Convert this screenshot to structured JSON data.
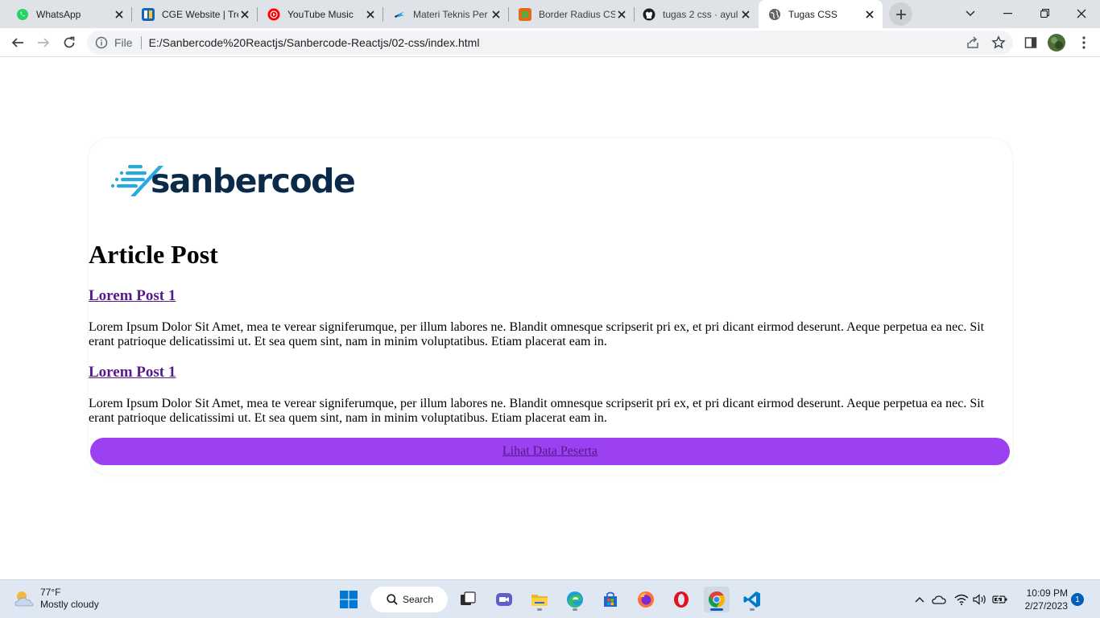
{
  "browser": {
    "tabs": [
      {
        "title": "WhatsApp",
        "icon": "whatsapp-icon"
      },
      {
        "title": "CGE Website | Tre",
        "icon": "cge-icon"
      },
      {
        "title": "YouTube Music",
        "icon": "youtube-music-icon"
      },
      {
        "title": "Materi Teknis Per",
        "icon": "materi-icon"
      },
      {
        "title": "Border Radius CS",
        "icon": "border-radius-icon"
      },
      {
        "title": "tugas 2 css · ayul",
        "icon": "github-icon"
      },
      {
        "title": "Tugas CSS",
        "icon": "globe-icon"
      }
    ],
    "address": {
      "scheme_label": "File",
      "url": "E:/Sanbercode%20Reactjs/Sanbercode-Reactjs/02-css/index.html"
    }
  },
  "page": {
    "logo_text": "Sanbercode",
    "heading": "Article Post",
    "posts": [
      {
        "title": "Lorem Post 1",
        "body": "Lorem Ipsum Dolor Sit Amet, mea te verear signiferumque, per illum labores ne. Blandit omnesque scripserit pri ex, et pri dicant eirmod deserunt. Aeque perpetua ea nec. Sit erant patrioque delicatissimi ut. Et sea quem sint, nam in minim voluptatibus. Etiam placerat eam in."
      },
      {
        "title": "Lorem Post 1",
        "body": "Lorem Ipsum Dolor Sit Amet, mea te verear signiferumque, per illum labores ne. Blandit omnesque scripserit pri ex, et pri dicant eirmod deserunt. Aeque perpetua ea nec. Sit erant patrioque delicatissimi ut. Et sea quem sint, nam in minim voluptatibus. Etiam placerat eam in."
      }
    ],
    "cta_label": "Lihat Data Peserta",
    "colors": {
      "cta_background": "#9b41f2",
      "visited_link": "#551a8b",
      "logo_dark": "#0b2a4a",
      "logo_accent": "#29a9e1"
    }
  },
  "taskbar": {
    "weather": {
      "temperature": "77°F",
      "condition": "Mostly cloudy"
    },
    "search_label": "Search",
    "apps": [
      "start-icon",
      "task-view-icon",
      "meet-icon",
      "file-explorer-icon",
      "edge-icon",
      "store-icon",
      "firefox-icon",
      "opera-icon",
      "chrome-icon",
      "vscode-icon"
    ],
    "clock": {
      "time": "10:09 PM",
      "date": "2/27/2023"
    },
    "notification_count": "1"
  }
}
